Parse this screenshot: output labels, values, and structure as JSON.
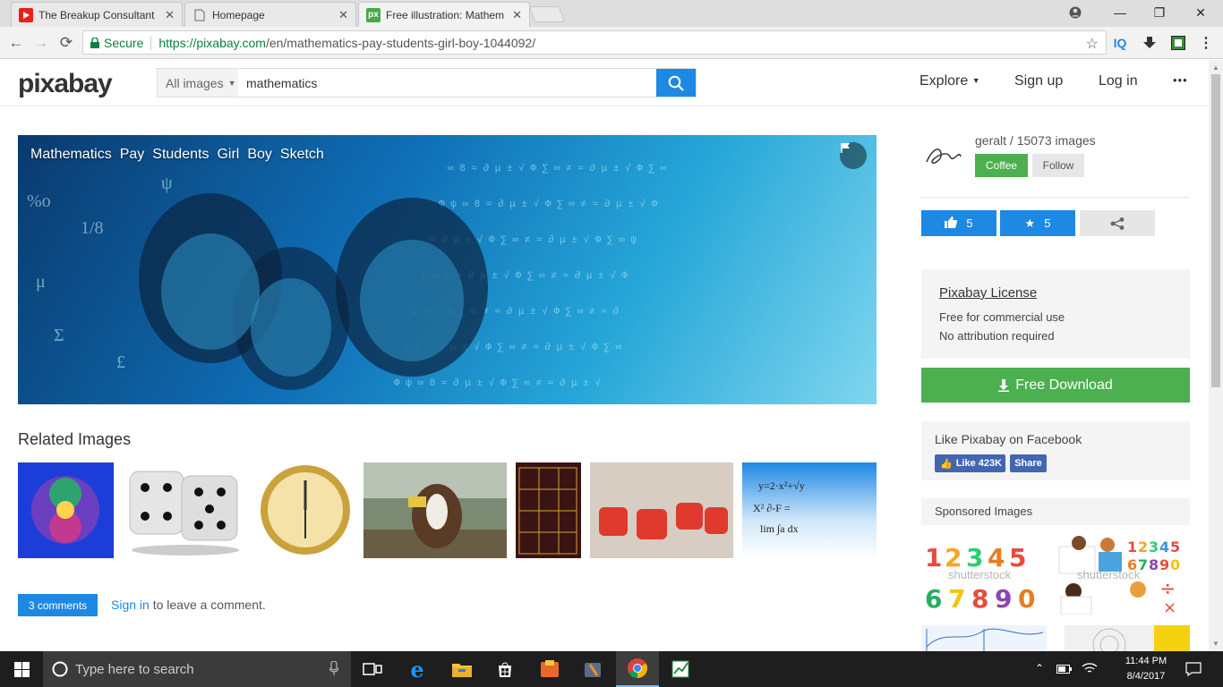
{
  "browser": {
    "tabs": [
      {
        "label": "The Breakup Consultant",
        "favicon": "youtube-icon"
      },
      {
        "label": "Homepage",
        "favicon": "page-icon"
      },
      {
        "label": "Free illustration: Mathem",
        "favicon": "pixabay-icon"
      }
    ],
    "secure_label": "Secure",
    "url_base": "https://pixabay.com",
    "url_path": "/en/mathematics-pay-students-girl-boy-1044092/",
    "ext_iq": "IQ"
  },
  "header": {
    "logo": "pixabay",
    "search_scope": "All images",
    "search_query": "mathematics",
    "nav": {
      "explore": "Explore",
      "signup": "Sign up",
      "login": "Log in",
      "more": "•••"
    }
  },
  "image": {
    "tags": [
      "Mathematics",
      "Pay",
      "Students",
      "Girl",
      "Boy",
      "Sketch"
    ]
  },
  "related": {
    "title": "Related Images",
    "thumbs": [
      "fractal",
      "dice-3d",
      "clock",
      "cow",
      "calendar-2018",
      "red-dice",
      "formulas"
    ]
  },
  "comments": {
    "button": "3 comments",
    "signin": "Sign in",
    "rest": " to leave a comment."
  },
  "author": {
    "name_line": "geralt / 15073 images",
    "coffee": "Coffee",
    "follow": "Follow"
  },
  "stats": {
    "likes": "5",
    "favorites": "5"
  },
  "license": {
    "title": "Pixabay License",
    "line1": "Free for commercial use",
    "line2": "No attribution required"
  },
  "download": {
    "label": "Free Download"
  },
  "facebook": {
    "title": "Like Pixabay on Facebook",
    "like": "Like 423K",
    "share": "Share"
  },
  "sponsored": {
    "title": "Sponsored Images",
    "watermark": "shutterstock"
  },
  "taskbar": {
    "search_placeholder": "Type here to search",
    "time": "11:44 PM",
    "date": "8/4/2017"
  },
  "colors": {
    "accent": "#1e88e5",
    "green": "#4caf50"
  }
}
